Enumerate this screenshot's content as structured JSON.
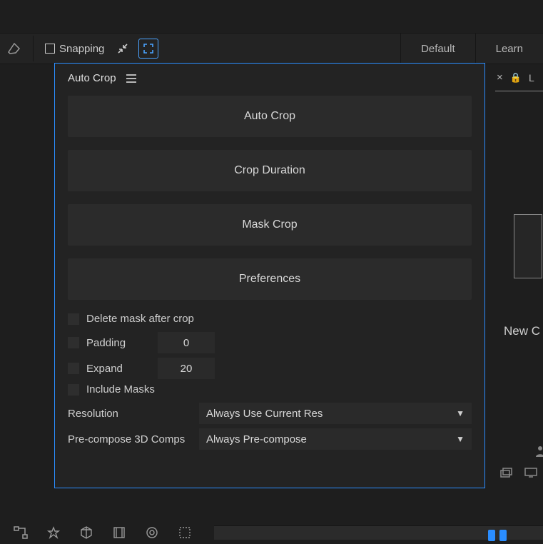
{
  "topbar": {
    "snapping_label": "Snapping",
    "tabs": {
      "default": "Default",
      "learn": "Learn"
    }
  },
  "panel": {
    "title": "Auto Crop",
    "buttons": {
      "auto_crop": "Auto Crop",
      "crop_duration": "Crop Duration",
      "mask_crop": "Mask Crop",
      "preferences": "Preferences"
    },
    "options": {
      "delete_mask": "Delete mask after crop",
      "padding_label": "Padding",
      "padding_value": "0",
      "expand_label": "Expand",
      "expand_value": "20",
      "include_masks": "Include Masks"
    },
    "selects": {
      "resolution_label": "Resolution",
      "resolution_value": "Always Use Current Res",
      "precompose_label": "Pre-compose 3D Comps",
      "precompose_value": "Always Pre-compose"
    }
  },
  "right": {
    "truncated_tab": "L",
    "new_label": "New C"
  }
}
